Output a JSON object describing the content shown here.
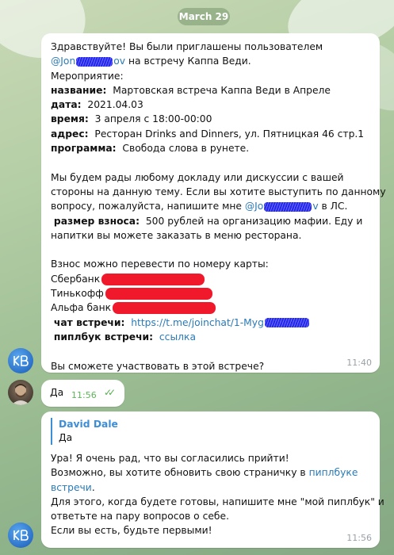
{
  "date_pill": "March 29",
  "colors": {
    "link": "#2a7ab8",
    "bubble": "#ffffff",
    "read_check": "#54b04c"
  },
  "message1": {
    "greet_prefix": "Здравствуйте! Вы были приглашены пользователем",
    "user_prefix": "@Jon",
    "user_suffix": "ov",
    "greet_suffix": "на встречу Каппа Веди.",
    "event_heading": "Мероприятие:",
    "name_label": "название:",
    "name_value": "Мартовская встреча Каппа Веди в Апреле",
    "date_label": "дата:",
    "date_value": "2021.04.03",
    "time_label": "время:",
    "time_value": "3 апреля с 18:00-00:00",
    "address_label": "адрес:",
    "address_value": "Ресторан Drinks and Dinners, ул. Пятницкая 46 стр.1",
    "program_label": "программа:",
    "program_value": "Свобода слова в рунете.",
    "p2_l1": "Мы будем рады любому докладу или дискуссии с вашей",
    "p2_l2": "стороны на данную тему. Если вы хотите выступить по данному",
    "p2_l3_prefix": "вопросу, пожалуйста, напишите мне",
    "p2_l3_user_prefix": "@Jo",
    "p2_l3_user_suffix": "v",
    "p2_l3_suffix": "в ЛС.",
    "fee_label": "размер взноса:",
    "fee_value": "500 рублей на организацию мафии. Еду и",
    "p2_l5": "напитки вы можете заказать в меню ресторана.",
    "p3_l1": "Взнос можно перевести по номеру карты:",
    "bank1": "Сбербанк",
    "bank2": "Тинькофф",
    "bank3": "Альфа банк",
    "chat_label": "чат встречи:",
    "chat_link": "https://t.me/joinchat/1-Myg",
    "peoplebook_label": "пиплбук встречи:",
    "peoplebook_link": "ссылка",
    "question": "Вы сможете участвовать в этой встрече?",
    "time": "11:40"
  },
  "message2": {
    "text": "Да",
    "time": "11:56",
    "status": "read-double-check"
  },
  "message3": {
    "quote_author": "David Dale",
    "quote_text": "Да",
    "l1": "Ура! Я очень рад, что вы согласились прийти!",
    "l2_prefix": "Возможно, вы хотите обновить свою страничку в",
    "l2_link": "пиплбуке",
    "l3_link": "встречи",
    "l3_suffix": ".",
    "l4": "Для этого, когда будете готовы, напишите мне \"мой пиплбук\" и",
    "l5": "ответьте на пару вопросов о себе.",
    "l6": "Если вы есть, будьте первыми!",
    "time": "11:56"
  }
}
